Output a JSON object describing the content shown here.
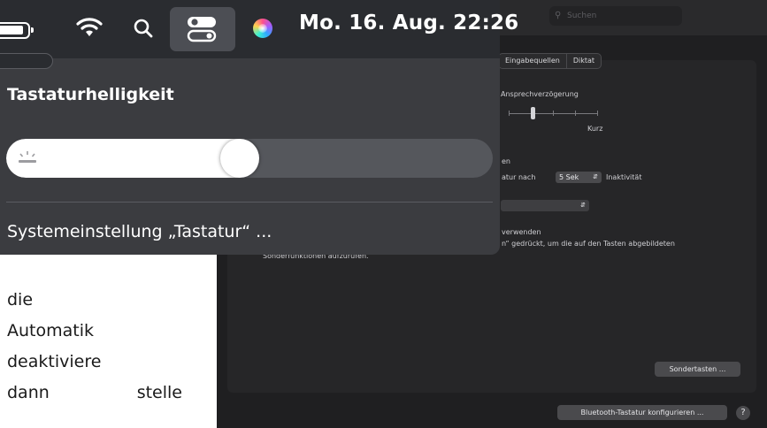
{
  "menubar": {
    "clock": "Mo. 16. Aug.  22:26"
  },
  "control_panel": {
    "title": "Tastaturhelligkeit",
    "brightness_percent": 48,
    "settings_link": "Systemeinstellung „Tastatur“ ..."
  },
  "prefs": {
    "search_placeholder": "Suchen",
    "tabs": [
      "Eingabequellen",
      "Diktat"
    ],
    "repeat_delay_label": "Ansprechverzögerung",
    "short_label": "Kurz",
    "section_label": "en",
    "backlight_off_prefix": "atur nach",
    "backlight_off_value": "5 Sek",
    "backlight_off_suffix": "Inaktivität",
    "fn_use": "verwenden",
    "fn_desc": "n“ gedrückt, um die auf den Tasten abgebildeten",
    "fn_desc2": "Sonderfunktionen aufzurufen.",
    "modifier_button": "Sondertasten ...",
    "bluetooth_button": "Bluetooth-Tastatur konfigurieren ...",
    "help": "?"
  },
  "page_text": {
    "line1": "die",
    "line2": "Automatik",
    "line3": "deaktiviere",
    "line4_a": "dann",
    "line4_b": "stelle"
  }
}
